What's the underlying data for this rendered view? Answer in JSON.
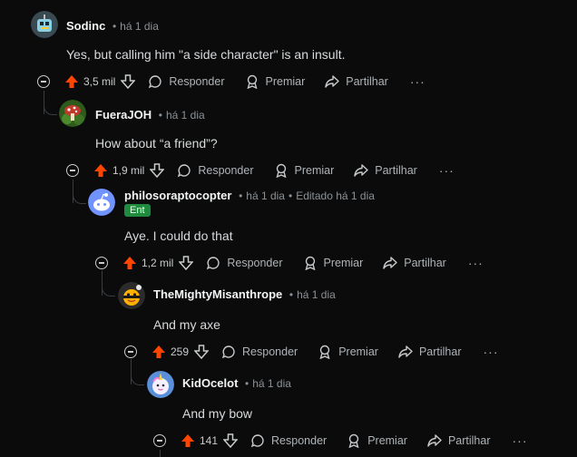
{
  "labels": {
    "reply": "Responder",
    "award": "Premiar",
    "share": "Partilhar",
    "more": "···",
    "edited": "Editado há 1 dia"
  },
  "colors": {
    "upvote": "#ff4500",
    "flair_bg": "#1f8b3e"
  },
  "comments": [
    {
      "author": "Sodinc",
      "time": "há 1 dia",
      "text": "Yes, but calling him \"a side character\" is an insult.",
      "votes": "3,5 mil",
      "avatar": "robot-avatar"
    },
    {
      "author": "FueraJOH",
      "time": "há 1 dia",
      "text": "How about “a friend”?",
      "votes": "1,9 mil",
      "avatar": "mushroom-avatar"
    },
    {
      "author": "philosoraptocopter",
      "time": "há 1 dia",
      "flair": "Ent",
      "text": "Aye. I could do that",
      "votes": "1,2 mil",
      "avatar": "default-snoo-avatar"
    },
    {
      "author": "TheMightyMisanthrope",
      "time": "há 1 dia",
      "text": "And my axe",
      "votes": "259",
      "avatar": "bee-avatar"
    },
    {
      "author": "KidOcelot",
      "time": "há 1 dia",
      "text": "And my bow",
      "votes": "141",
      "avatar": "unicorn-avatar"
    }
  ]
}
